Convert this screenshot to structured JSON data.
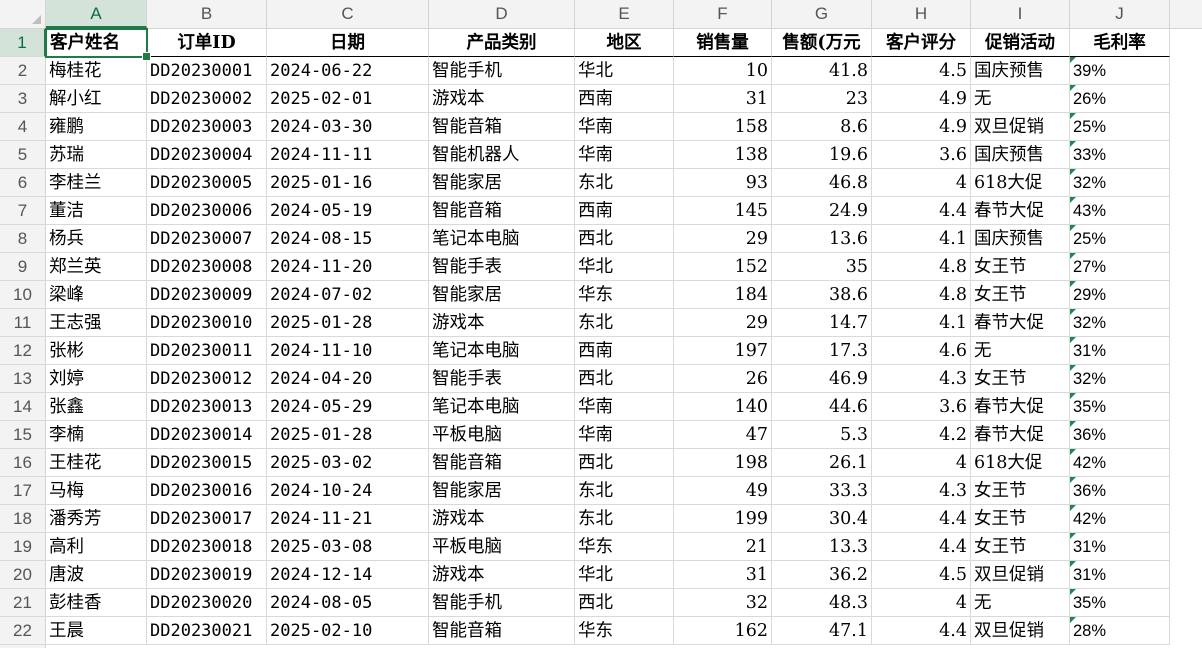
{
  "columns": [
    "A",
    "B",
    "C",
    "D",
    "E",
    "F",
    "G",
    "H",
    "I",
    "J"
  ],
  "active_column": "A",
  "active_row": "1",
  "selected_cell": "A1",
  "row_numbers": [
    "1",
    "2",
    "3",
    "4",
    "5",
    "6",
    "7",
    "8",
    "9",
    "10",
    "11",
    "12",
    "13",
    "14",
    "15",
    "16",
    "17",
    "18",
    "19",
    "20",
    "21",
    "22"
  ],
  "headers": [
    "客户姓名",
    "订单ID",
    "日期",
    "产品类别",
    "地区",
    "销售量",
    "售额(万元",
    "客户评分",
    "促销活动",
    "毛利率"
  ],
  "rows": [
    [
      "梅桂花",
      "DD20230001",
      "2024-06-22",
      "智能手机",
      "华北",
      "10",
      "41.8",
      "4.5",
      "国庆预售",
      "39%"
    ],
    [
      "解小红",
      "DD20230002",
      "2025-02-01",
      "游戏本",
      "西南",
      "31",
      "23",
      "4.9",
      "无",
      "26%"
    ],
    [
      "雍鹏",
      "DD20230003",
      "2024-03-30",
      "智能音箱",
      "华南",
      "158",
      "8.6",
      "4.9",
      "双旦促销",
      "25%"
    ],
    [
      "苏瑞",
      "DD20230004",
      "2024-11-11",
      "智能机器人",
      "华南",
      "138",
      "19.6",
      "3.6",
      "国庆预售",
      "33%"
    ],
    [
      "李桂兰",
      "DD20230005",
      "2025-01-16",
      "智能家居",
      "东北",
      "93",
      "46.8",
      "4",
      "618大促",
      "32%"
    ],
    [
      "董洁",
      "DD20230006",
      "2024-05-19",
      "智能音箱",
      "西南",
      "145",
      "24.9",
      "4.4",
      "春节大促",
      "43%"
    ],
    [
      "杨兵",
      "DD20230007",
      "2024-08-15",
      "笔记本电脑",
      "西北",
      "29",
      "13.6",
      "4.1",
      "国庆预售",
      "25%"
    ],
    [
      "郑兰英",
      "DD20230008",
      "2024-11-20",
      "智能手表",
      "华北",
      "152",
      "35",
      "4.8",
      "女王节",
      "27%"
    ],
    [
      "梁峰",
      "DD20230009",
      "2024-07-02",
      "智能家居",
      "华东",
      "184",
      "38.6",
      "4.8",
      "女王节",
      "29%"
    ],
    [
      "王志强",
      "DD20230010",
      "2025-01-28",
      "游戏本",
      "东北",
      "29",
      "14.7",
      "4.1",
      "春节大促",
      "32%"
    ],
    [
      "张彬",
      "DD20230011",
      "2024-11-10",
      "笔记本电脑",
      "西南",
      "197",
      "17.3",
      "4.6",
      "无",
      "31%"
    ],
    [
      "刘婷",
      "DD20230012",
      "2024-04-20",
      "智能手表",
      "西北",
      "26",
      "46.9",
      "4.3",
      "女王节",
      "32%"
    ],
    [
      "张鑫",
      "DD20230013",
      "2024-05-29",
      "笔记本电脑",
      "华南",
      "140",
      "44.6",
      "3.6",
      "春节大促",
      "35%"
    ],
    [
      "李楠",
      "DD20230014",
      "2025-01-28",
      "平板电脑",
      "华南",
      "47",
      "5.3",
      "4.2",
      "春节大促",
      "36%"
    ],
    [
      "王桂花",
      "DD20230015",
      "2025-03-02",
      "智能音箱",
      "西北",
      "198",
      "26.1",
      "4",
      "618大促",
      "42%"
    ],
    [
      "马梅",
      "DD20230016",
      "2024-10-24",
      "智能家居",
      "东北",
      "49",
      "33.3",
      "4.3",
      "女王节",
      "36%"
    ],
    [
      "潘秀芳",
      "DD20230017",
      "2024-11-21",
      "游戏本",
      "东北",
      "199",
      "30.4",
      "4.4",
      "女王节",
      "42%"
    ],
    [
      "高利",
      "DD20230018",
      "2025-03-08",
      "平板电脑",
      "华东",
      "21",
      "13.3",
      "4.4",
      "女王节",
      "31%"
    ],
    [
      "唐波",
      "DD20230019",
      "2024-12-14",
      "游戏本",
      "华北",
      "31",
      "36.2",
      "4.5",
      "双旦促销",
      "31%"
    ],
    [
      "彭桂香",
      "DD20230020",
      "2024-08-05",
      "智能手机",
      "西北",
      "32",
      "48.3",
      "4",
      "无",
      "35%"
    ],
    [
      "王晨",
      "DD20230021",
      "2025-02-10",
      "智能音箱",
      "华东",
      "162",
      "47.1",
      "4.4",
      "双旦促销",
      "28%"
    ]
  ],
  "colors": {
    "accent": "#1f7a47",
    "header_bg": "#f3f3f3",
    "active_header_bg": "#d3e3da",
    "gridline": "#d9d9d9",
    "text_flag": "#1f8a4c"
  }
}
